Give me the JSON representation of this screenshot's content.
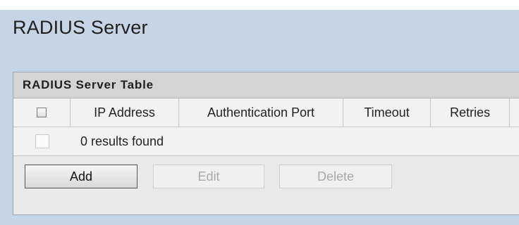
{
  "page": {
    "title": "RADIUS Server"
  },
  "table": {
    "caption": "RADIUS Server Table",
    "columns": [
      "IP Address",
      "Authentication Port",
      "Timeout",
      "Retries"
    ],
    "results_text": "0 results found"
  },
  "buttons": {
    "add": "Add",
    "edit": "Edit",
    "delete": "Delete"
  },
  "colors": {
    "background": "#c5d5e5",
    "caption_bg": "#d4d4d4",
    "table_bg": "#f2f2f2"
  }
}
